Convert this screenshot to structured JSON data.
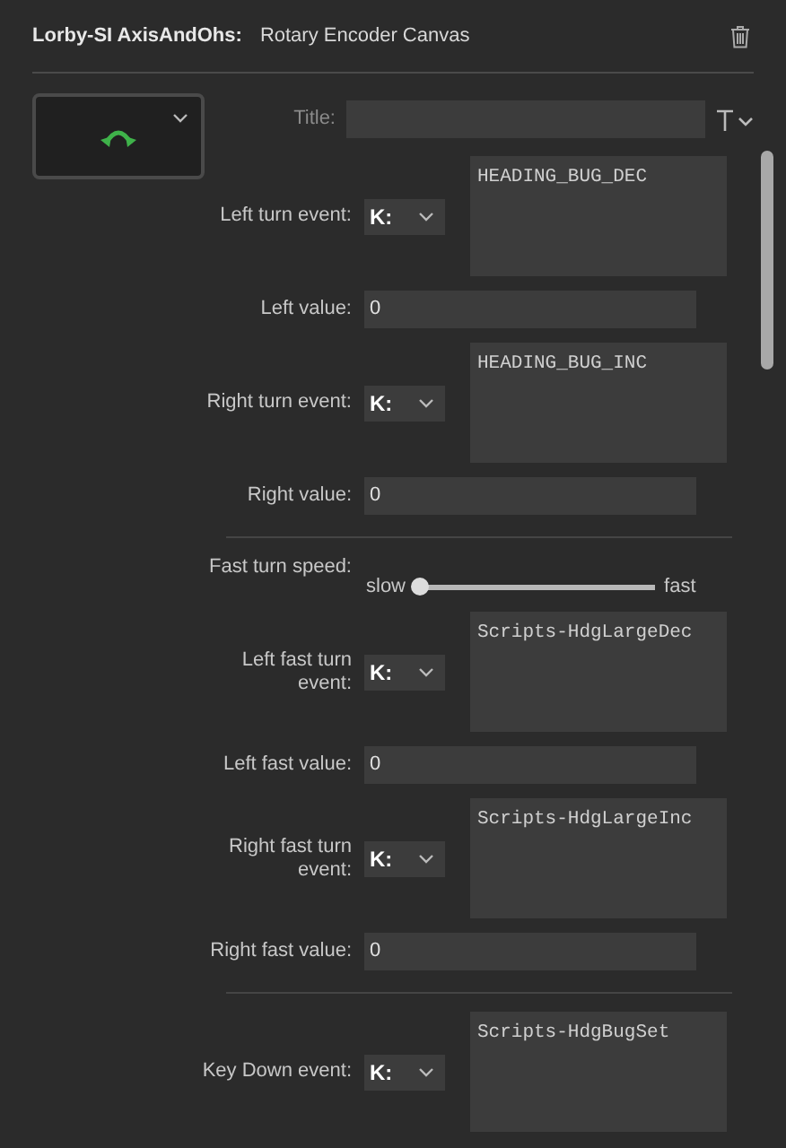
{
  "header": {
    "plugin": "Lorby-SI AxisAndOhs:",
    "action": "Rotary Encoder Canvas"
  },
  "title_field": {
    "label": "Title:"
  },
  "sections": [
    [
      {
        "kind": "event",
        "label": "Left turn event:",
        "prefix": "K:",
        "value": "HEADING_BUG_DEC"
      },
      {
        "kind": "value",
        "label": "Left value:",
        "value": "0"
      },
      {
        "kind": "event",
        "label": "Right turn event:",
        "prefix": "K:",
        "value": "HEADING_BUG_INC"
      },
      {
        "kind": "value",
        "label": "Right value:",
        "value": "0"
      }
    ],
    [
      {
        "kind": "slider",
        "label": "Fast turn speed:",
        "min_label": "slow",
        "max_label": "fast",
        "level": 0
      },
      {
        "kind": "event",
        "label": "Left fast turn event:",
        "prefix": "K:",
        "value": "Scripts-HdgLargeDec"
      },
      {
        "kind": "value",
        "label": "Left fast value:",
        "value": "0"
      },
      {
        "kind": "event",
        "label": "Right fast turn event:",
        "prefix": "K:",
        "value": "Scripts-HdgLargeInc"
      },
      {
        "kind": "value",
        "label": "Right fast value:",
        "value": "0"
      }
    ],
    [
      {
        "kind": "event",
        "label": "Key Down event:",
        "prefix": "K:",
        "value": "Scripts-HdgBugSet"
      }
    ]
  ]
}
